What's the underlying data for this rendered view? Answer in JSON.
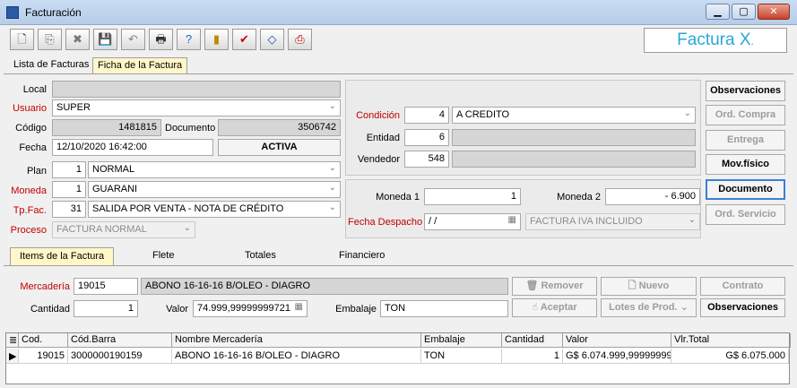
{
  "window": {
    "title": "Facturación",
    "minimize": "▁",
    "maximize": "▢",
    "close": "✕"
  },
  "toolbar": {
    "buttons": [
      {
        "name": "new-doc-icon",
        "glyph": "🗋"
      },
      {
        "name": "copy-doc-icon",
        "glyph": "⎘"
      },
      {
        "name": "delete-icon",
        "glyph": "✖"
      },
      {
        "name": "save-icon",
        "glyph": "💾"
      },
      {
        "name": "undo-icon",
        "glyph": "↶"
      },
      {
        "name": "printer-icon",
        "glyph": "🖶"
      },
      {
        "name": "help-icon",
        "glyph": "?"
      },
      {
        "name": "exit-door-icon",
        "glyph": "▮"
      },
      {
        "name": "check-icon",
        "glyph": "✔"
      },
      {
        "name": "eraser-icon",
        "glyph": "◇"
      },
      {
        "name": "print-cancel-icon",
        "glyph": "⎙"
      }
    ],
    "brand": "Factura X",
    "brand_dot": "."
  },
  "tabs": {
    "list": "Lista de Facturas",
    "detail": "Ficha de la Factura"
  },
  "header": {
    "local_label": "Local",
    "usuario_label": "Usuario",
    "usuario_value": "SUPER",
    "codigo_label": "Código",
    "codigo_value": "1481815",
    "documento_label": "Documento",
    "documento_value": "3506742",
    "fecha_label": "Fecha",
    "fecha_value": "12/10/2020 16:42:00",
    "status": "ACTIVA",
    "plan_label": "Plan",
    "plan_code": "1",
    "plan_value": "NORMAL",
    "moneda_label": "Moneda",
    "moneda_code": "1",
    "moneda_value": "GUARANI",
    "tpfac_label": "Tp.Fac.",
    "tpfac_code": "31",
    "tpfac_value": "SALIDA POR VENTA - NOTA DE CRÉDITO",
    "proceso_label": "Proceso",
    "proceso_value": "FACTURA NORMAL"
  },
  "condicion": {
    "condicion_label": "Condición",
    "condicion_code": "4",
    "condicion_value": "A CREDITO",
    "entidad_label": "Entidad",
    "entidad_code": "6",
    "vendedor_label": "Vendedor",
    "vendedor_code": "548"
  },
  "moneda_box": {
    "moneda1_label": "Moneda 1",
    "moneda1_value": "1",
    "moneda2_label": "Moneda 2",
    "moneda2_value": "- 6.900",
    "fecha_despacho_label": "Fecha Despacho",
    "fecha_despacho_value": " /  /",
    "iva_value": "FACTURA IVA INCLUIDO"
  },
  "side_buttons": {
    "observaciones": "Observaciones",
    "ord_compra": "Ord. Compra",
    "entrega": "Entrega",
    "mov_fisico": "Mov.físico",
    "documento": "Documento",
    "ord_servicio": "Ord. Servicio"
  },
  "sub_tabs": {
    "items": "Items de la Factura",
    "flete": "Flete",
    "totales": "Totales",
    "financiero": "Financiero"
  },
  "item_form": {
    "mercaderia_label": "Mercadería",
    "mercaderia_code": "19015",
    "mercaderia_value": "ABONO 16-16-16  B/OLEO - DIAGRO",
    "cantidad_label": "Cantidad",
    "cantidad_value": "1",
    "valor_label": "Valor",
    "valor_value": "74.999,99999999721",
    "embalaje_label": "Embalaje",
    "embalaje_value": "TON",
    "remover": "Remover",
    "nuevo": "Nuevo",
    "contrato": "Contrato",
    "aceptar": "Aceptar",
    "lotes": "Lotes de Prod.",
    "observaciones": "Observaciones"
  },
  "grid": {
    "headers": [
      "Cod.",
      "Cód.Barra",
      "Nombre Mercadería",
      "Embalaje",
      "Cantidad",
      "Valor",
      "Vlr.Total"
    ],
    "row": [
      "19015",
      "3000000190159",
      "ABONO 16-16-16  B/OLEO - DIAGRO",
      "TON",
      "1",
      "G$ 6.074.999,99999999",
      "G$ 6.075.000"
    ]
  }
}
